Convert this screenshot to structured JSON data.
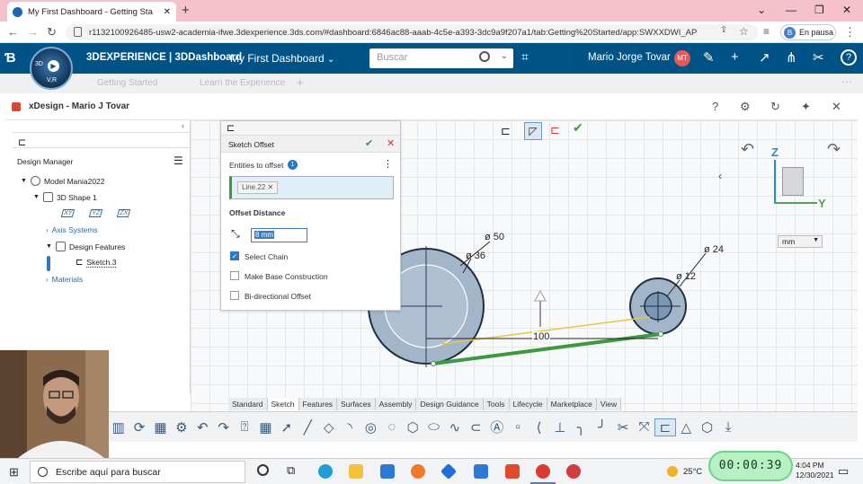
{
  "browser": {
    "tab_title": "My First Dashboard - Getting Sta",
    "url": "r1132100926485-usw2-academia-ifwe.3dexperience.3ds.com/#dashboard:6846ac88-aaab-4c5e-a393-3dc9a9f207a1/tab:Getting%20Started/app:SWXXDWI_AP",
    "profile_label": "En pausa",
    "profile_initial": "B"
  },
  "topbar": {
    "brand": "3DEXPERIENCE | 3DDashboard",
    "dashboard": "My First Dashboard",
    "search_placeholder": "Buscar",
    "user_name": "Mario Jorge Tovar",
    "user_initials": "MT",
    "compass_top": "3D",
    "compass_bottom": "V,R"
  },
  "dash_tabs": [
    "Getting Started",
    "Learn the Experience"
  ],
  "app": {
    "title": "xDesign - Mario J Tovar"
  },
  "tree": {
    "manager_label": "Design Manager",
    "model": "Model Mania2022",
    "shape": "3D Shape 1",
    "planes": [
      "XY",
      "YZ",
      "ZX"
    ],
    "axis_systems": "Axis Systems",
    "design_features": "Design Features",
    "sketch": "Sketch.3",
    "materials": "Materials"
  },
  "offset_panel": {
    "title": "Sketch Offset",
    "entities_label": "Entities to offset",
    "entities_count": "1",
    "entity_chip": "Line.22",
    "distance_label": "Offset Distance",
    "distance_value": "8 mm",
    "options": [
      {
        "label": "Select Chain",
        "checked": true
      },
      {
        "label": "Make Base Construction",
        "checked": false
      },
      {
        "label": "Bi-directional Offset",
        "checked": false
      }
    ]
  },
  "sketch": {
    "dim_d50": "ø 50",
    "dim_d36": "ø 36",
    "dim_d24": "ø 24",
    "dim_d12": "ø 12",
    "dim_100": "100",
    "unit": "mm"
  },
  "view_cube": {
    "z_label": "Z",
    "y_label": "Y"
  },
  "ribbon_tabs": [
    "Standard",
    "Sketch",
    "Features",
    "Surfaces",
    "Assembly",
    "Design Guidance",
    "Tools",
    "Lifecycle",
    "Marketplace",
    "View"
  ],
  "active_ribbon_tab": "Sketch",
  "taskbar": {
    "search_placeholder": "Escribe aquí para buscar",
    "temperature": "25°C",
    "time": "4:04 PM",
    "date": "12/30/2021"
  },
  "timer": "00:00:39",
  "colors": {
    "topbar": "#005386",
    "tabbar": "#f5c2cc",
    "accent": "#2a79c2",
    "check_green": "#3b9a3e",
    "close_red": "#d33"
  }
}
